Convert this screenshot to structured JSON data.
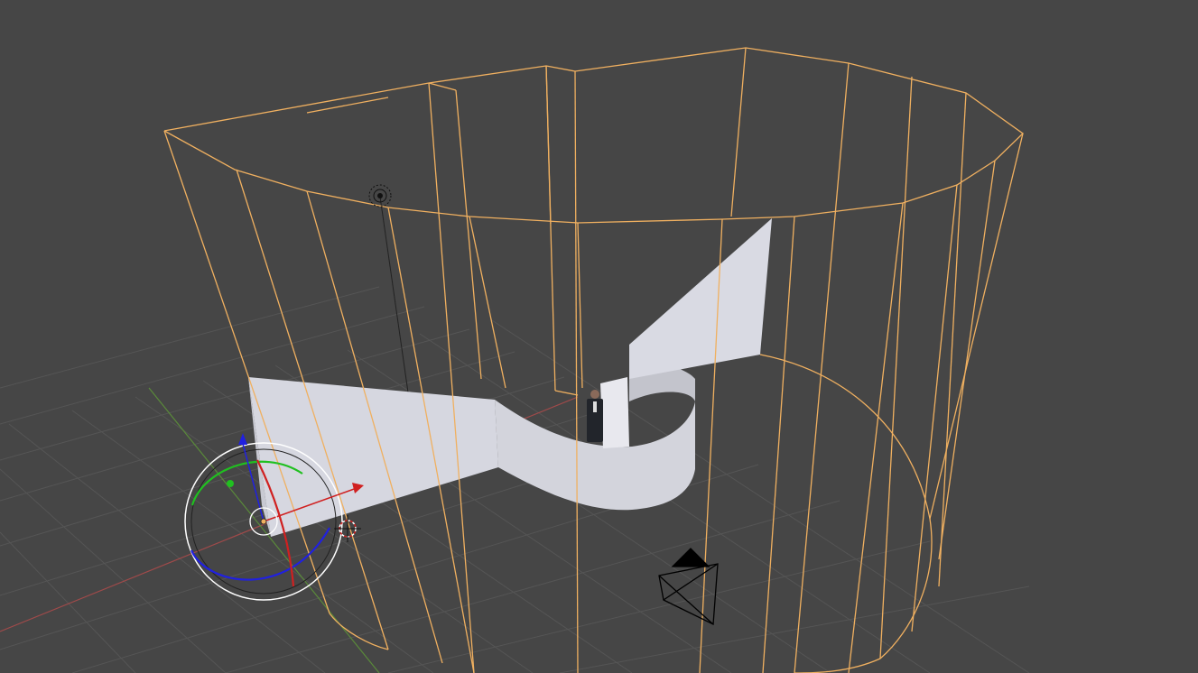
{
  "viewport": {
    "background": "#464646",
    "grid_color": "#555555",
    "x_axis_color": "#a04a4a",
    "y_axis_color": "#5a8a3a"
  },
  "selection": {
    "outline_color": "#f0b060",
    "object": "cylinder-wireframe"
  },
  "scene": {
    "objects": [
      {
        "name": "cylinder-wireframe",
        "kind": "mesh",
        "selected": true
      },
      {
        "name": "wall-panels",
        "kind": "mesh",
        "selected": false
      },
      {
        "name": "person-cutout",
        "kind": "image-plane",
        "selected": false
      },
      {
        "name": "lamp",
        "kind": "light",
        "icon": "lamp-icon"
      },
      {
        "name": "camera",
        "kind": "camera",
        "icon": "camera-icon"
      }
    ]
  },
  "gizmo": {
    "mode": "rotate",
    "axis_colors": {
      "x": "#d02020",
      "y": "#20c020",
      "z": "#2020e0"
    },
    "trackball_color": "#ffffff"
  },
  "cursor_3d": {
    "icon": "3d-cursor-icon"
  },
  "wall_color": "#d6d7e0",
  "wall_shadow_color": "#b8b9c2"
}
